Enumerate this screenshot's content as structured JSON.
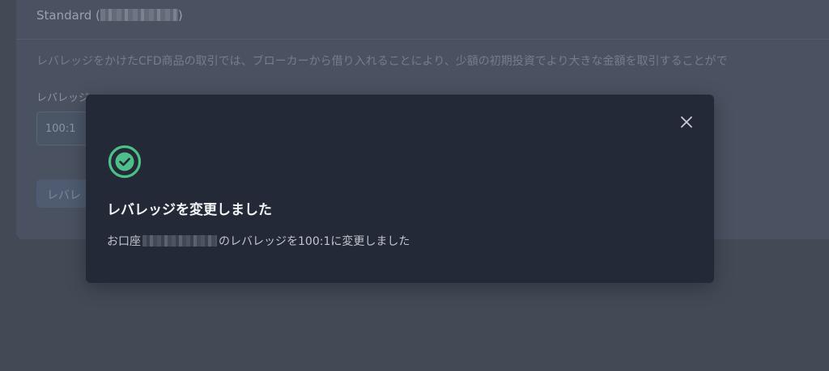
{
  "background": {
    "account_title_prefix": "Standard (",
    "account_title_suffix": ")",
    "description": "レバレッジをかけたCFD商品の取引では、ブローカーから借り入れることにより、少額の初期投資でより大きな金額を取引することがで",
    "leverage_label": "レバレッジ",
    "leverage_value": "100:1",
    "submit_label": "レバレ"
  },
  "modal": {
    "title": "レバレッジを変更しました",
    "message_prefix": "お口座",
    "message_suffix": "のレバレッジを100:1に変更しました",
    "icons": {
      "success": "check-circle-icon",
      "close": "close-icon"
    }
  },
  "colors": {
    "success": "#4fbf8a",
    "modal_background": "#232936",
    "page_background": "#434a56"
  }
}
